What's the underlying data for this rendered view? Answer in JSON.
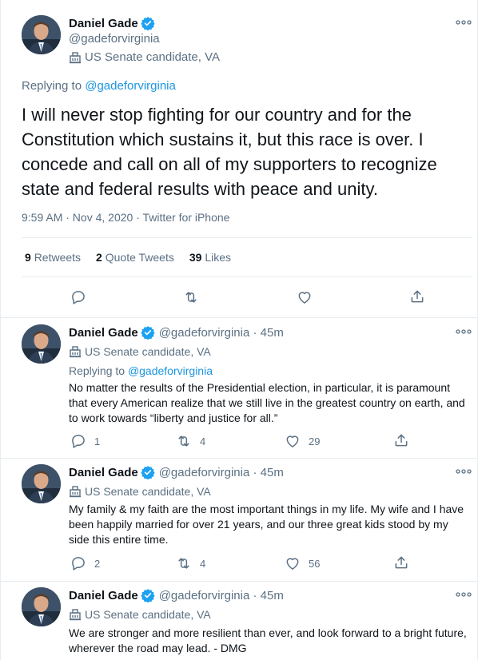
{
  "main_tweet": {
    "author_name": "Daniel Gade",
    "handle": "@gadeforvirginia",
    "label": "US Senate candidate, VA",
    "replying_prefix": "Replying to ",
    "replying_handle": "@gadeforvirginia",
    "text": "I will never stop fighting for our country and for the Constitution which sustains it, but this race is over. I concede and call on all of my supporters to recognize state and federal results with peace and unity.",
    "timestamp": "9:59 AM · Nov 4, 2020 · Twitter for iPhone",
    "retweets_count": "9",
    "retweets_label": "Retweets",
    "quote_count": "2",
    "quote_label": "Quote Tweets",
    "likes_count": "39",
    "likes_label": "Likes"
  },
  "replies": [
    {
      "author_name": "Daniel Gade",
      "handle_time": "@gadeforvirginia · 45m",
      "label": "US Senate candidate, VA",
      "replying_prefix": "Replying to ",
      "replying_handle": "@gadeforvirginia",
      "text": "No matter the results of the Presidential election, in particular, it is paramount that every American realize that we still live in the greatest country on earth, and to work towards “liberty and justice for all.”",
      "reply_count": "1",
      "retweet_count": "4",
      "like_count": "29"
    },
    {
      "author_name": "Daniel Gade",
      "handle_time": "@gadeforvirginia · 45m",
      "label": "US Senate candidate, VA",
      "text": "My family & my faith are the most important things in my life. My wife and I have been happily married for over 21 years, and our three great kids stood by my side this entire time.",
      "reply_count": "2",
      "retweet_count": "4",
      "like_count": "56"
    },
    {
      "author_name": "Daniel Gade",
      "handle_time": "@gadeforvirginia · 45m",
      "label": "US Senate candidate, VA",
      "text": "We are stronger and more resilient than ever, and look forward to a bright future, wherever the road may lead. - DMG"
    }
  ],
  "colors": {
    "accent": "#1b95e0",
    "verified": "#1da1f2",
    "muted": "#5b7083",
    "divider": "#e6ecf0"
  },
  "icons": [
    "verified-badge-icon",
    "building-icon",
    "more-icon",
    "reply-icon",
    "retweet-icon",
    "like-icon",
    "share-icon"
  ]
}
